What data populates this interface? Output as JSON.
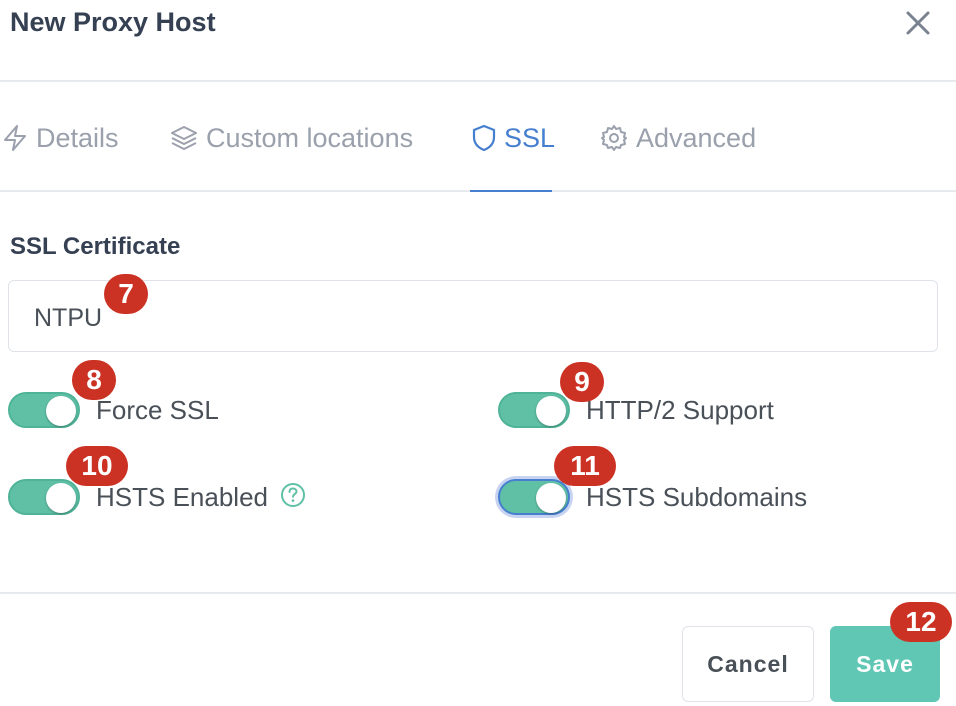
{
  "dialog": {
    "title": "New Proxy Host"
  },
  "tabs": [
    {
      "label": "Details",
      "icon": "lightning-icon"
    },
    {
      "label": "Custom locations",
      "icon": "layers-icon"
    },
    {
      "label": "SSL",
      "icon": "shield-icon",
      "active": true
    },
    {
      "label": "Advanced",
      "icon": "gear-icon"
    }
  ],
  "ssl": {
    "certificate_label": "SSL Certificate",
    "certificate_value": "NTPU"
  },
  "toggles": [
    {
      "label": "Force SSL",
      "on": true
    },
    {
      "label": "HTTP/2 Support",
      "on": true
    },
    {
      "label": "HSTS Enabled",
      "on": true
    },
    {
      "label": "HSTS Subdomains",
      "on": true
    }
  ],
  "badges": {
    "b7": "7",
    "b8": "8",
    "b9": "9",
    "b10": "10",
    "b11": "11",
    "b12": "12"
  },
  "footer": {
    "cancel_label": "Cancel",
    "save_label": "Save"
  },
  "colors": {
    "accent": "#467fcf",
    "toggle_on": "#5fc0a6",
    "save": "#5fc7b4",
    "badge": "#cc3224"
  }
}
